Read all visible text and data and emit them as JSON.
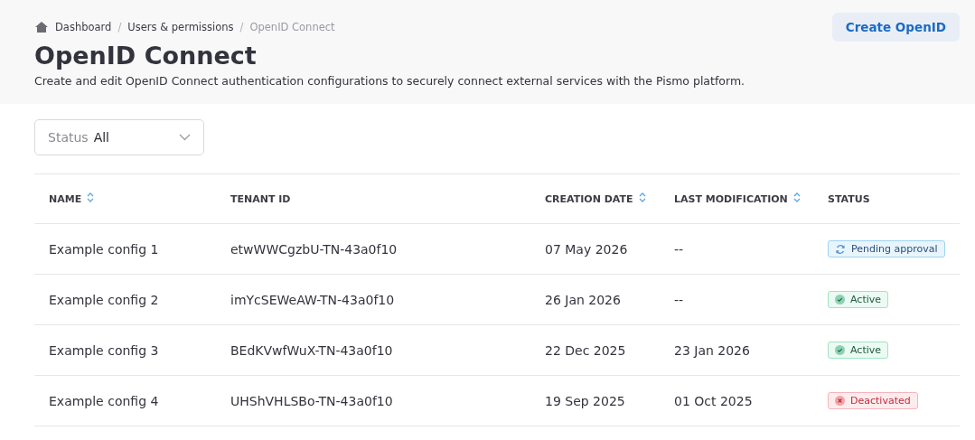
{
  "breadcrumb_separator": "/",
  "breadcrumb": [
    {
      "label": "Dashboard",
      "current": false
    },
    {
      "label": "Users & permissions",
      "current": false
    },
    {
      "label": "OpenID Connect",
      "current": true
    }
  ],
  "create_button": "Create OpenID",
  "title": "OpenID Connect",
  "description": "Create and edit OpenID Connect authentication configurations to securely connect external services with the Pismo platform.",
  "filter": {
    "label": "Status",
    "value": "All"
  },
  "table": {
    "columns": [
      {
        "label": "NAME",
        "sortable": true
      },
      {
        "label": "TENANT ID",
        "sortable": false
      },
      {
        "label": "CREATION DATE",
        "sortable": true
      },
      {
        "label": "LAST MODIFICATION",
        "sortable": true
      },
      {
        "label": "STATUS",
        "sortable": false
      }
    ],
    "rows": [
      {
        "name": "Example config 1",
        "tenant_id": "etwWWCgzbU-TN-43a0f10",
        "creation_date": "07 May 2026",
        "last_modification": "--",
        "status": {
          "kind": "pending",
          "label": "Pending approval"
        }
      },
      {
        "name": "Example config 2",
        "tenant_id": "imYcSEWeAW-TN-43a0f10",
        "creation_date": "26 Jan 2026",
        "last_modification": "--",
        "status": {
          "kind": "active",
          "label": "Active"
        }
      },
      {
        "name": "Example config 3",
        "tenant_id": "BEdKVwfWuX-TN-43a0f10",
        "creation_date": "22 Dec 2025",
        "last_modification": "23 Jan 2026",
        "status": {
          "kind": "active",
          "label": "Active"
        }
      },
      {
        "name": "Example config 4",
        "tenant_id": "UHShVHLSBo-TN-43a0f10",
        "creation_date": "19 Sep 2025",
        "last_modification": "01 Oct 2025",
        "status": {
          "kind": "deactivated",
          "label": "Deactivated"
        }
      }
    ]
  }
}
